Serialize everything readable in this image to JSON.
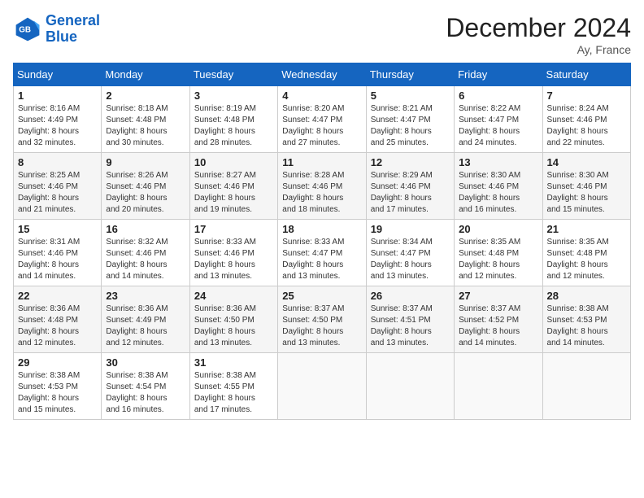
{
  "header": {
    "logo_line1": "General",
    "logo_line2": "Blue",
    "month_title": "December 2024",
    "location": "Ay, France"
  },
  "weekdays": [
    "Sunday",
    "Monday",
    "Tuesday",
    "Wednesday",
    "Thursday",
    "Friday",
    "Saturday"
  ],
  "weeks": [
    [
      {
        "day": 1,
        "sunrise": "8:16 AM",
        "sunset": "4:49 PM",
        "daylight": "8 hours and 32 minutes."
      },
      {
        "day": 2,
        "sunrise": "8:18 AM",
        "sunset": "4:48 PM",
        "daylight": "8 hours and 30 minutes."
      },
      {
        "day": 3,
        "sunrise": "8:19 AM",
        "sunset": "4:48 PM",
        "daylight": "8 hours and 28 minutes."
      },
      {
        "day": 4,
        "sunrise": "8:20 AM",
        "sunset": "4:47 PM",
        "daylight": "8 hours and 27 minutes."
      },
      {
        "day": 5,
        "sunrise": "8:21 AM",
        "sunset": "4:47 PM",
        "daylight": "8 hours and 25 minutes."
      },
      {
        "day": 6,
        "sunrise": "8:22 AM",
        "sunset": "4:47 PM",
        "daylight": "8 hours and 24 minutes."
      },
      {
        "day": 7,
        "sunrise": "8:24 AM",
        "sunset": "4:46 PM",
        "daylight": "8 hours and 22 minutes."
      }
    ],
    [
      {
        "day": 8,
        "sunrise": "8:25 AM",
        "sunset": "4:46 PM",
        "daylight": "8 hours and 21 minutes."
      },
      {
        "day": 9,
        "sunrise": "8:26 AM",
        "sunset": "4:46 PM",
        "daylight": "8 hours and 20 minutes."
      },
      {
        "day": 10,
        "sunrise": "8:27 AM",
        "sunset": "4:46 PM",
        "daylight": "8 hours and 19 minutes."
      },
      {
        "day": 11,
        "sunrise": "8:28 AM",
        "sunset": "4:46 PM",
        "daylight": "8 hours and 18 minutes."
      },
      {
        "day": 12,
        "sunrise": "8:29 AM",
        "sunset": "4:46 PM",
        "daylight": "8 hours and 17 minutes."
      },
      {
        "day": 13,
        "sunrise": "8:30 AM",
        "sunset": "4:46 PM",
        "daylight": "8 hours and 16 minutes."
      },
      {
        "day": 14,
        "sunrise": "8:30 AM",
        "sunset": "4:46 PM",
        "daylight": "8 hours and 15 minutes."
      }
    ],
    [
      {
        "day": 15,
        "sunrise": "8:31 AM",
        "sunset": "4:46 PM",
        "daylight": "8 hours and 14 minutes."
      },
      {
        "day": 16,
        "sunrise": "8:32 AM",
        "sunset": "4:46 PM",
        "daylight": "8 hours and 14 minutes."
      },
      {
        "day": 17,
        "sunrise": "8:33 AM",
        "sunset": "4:46 PM",
        "daylight": "8 hours and 13 minutes."
      },
      {
        "day": 18,
        "sunrise": "8:33 AM",
        "sunset": "4:47 PM",
        "daylight": "8 hours and 13 minutes."
      },
      {
        "day": 19,
        "sunrise": "8:34 AM",
        "sunset": "4:47 PM",
        "daylight": "8 hours and 13 minutes."
      },
      {
        "day": 20,
        "sunrise": "8:35 AM",
        "sunset": "4:48 PM",
        "daylight": "8 hours and 12 minutes."
      },
      {
        "day": 21,
        "sunrise": "8:35 AM",
        "sunset": "4:48 PM",
        "daylight": "8 hours and 12 minutes."
      }
    ],
    [
      {
        "day": 22,
        "sunrise": "8:36 AM",
        "sunset": "4:48 PM",
        "daylight": "8 hours and 12 minutes."
      },
      {
        "day": 23,
        "sunrise": "8:36 AM",
        "sunset": "4:49 PM",
        "daylight": "8 hours and 12 minutes."
      },
      {
        "day": 24,
        "sunrise": "8:36 AM",
        "sunset": "4:50 PM",
        "daylight": "8 hours and 13 minutes."
      },
      {
        "day": 25,
        "sunrise": "8:37 AM",
        "sunset": "4:50 PM",
        "daylight": "8 hours and 13 minutes."
      },
      {
        "day": 26,
        "sunrise": "8:37 AM",
        "sunset": "4:51 PM",
        "daylight": "8 hours and 13 minutes."
      },
      {
        "day": 27,
        "sunrise": "8:37 AM",
        "sunset": "4:52 PM",
        "daylight": "8 hours and 14 minutes."
      },
      {
        "day": 28,
        "sunrise": "8:38 AM",
        "sunset": "4:53 PM",
        "daylight": "8 hours and 14 minutes."
      }
    ],
    [
      {
        "day": 29,
        "sunrise": "8:38 AM",
        "sunset": "4:53 PM",
        "daylight": "8 hours and 15 minutes."
      },
      {
        "day": 30,
        "sunrise": "8:38 AM",
        "sunset": "4:54 PM",
        "daylight": "8 hours and 16 minutes."
      },
      {
        "day": 31,
        "sunrise": "8:38 AM",
        "sunset": "4:55 PM",
        "daylight": "8 hours and 17 minutes."
      },
      null,
      null,
      null,
      null
    ]
  ]
}
